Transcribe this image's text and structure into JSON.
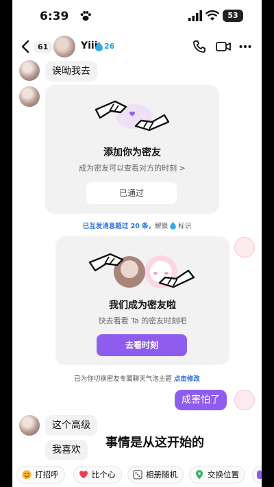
{
  "status_bar": {
    "time": "6:39",
    "battery": "53"
  },
  "header": {
    "unread_count": "61",
    "name": "Yiii",
    "level": "26"
  },
  "messages": {
    "first": "诶呦我去",
    "card1": {
      "title": "添加你为密友",
      "subtitle": "成为密友可以查看对方的时刻 >",
      "button": "已通过"
    },
    "notice1": {
      "prefix": "已互发消息超过 20 条，",
      "action": "解锁",
      "suffix": "标识"
    },
    "card2": {
      "title": "我们成为密友啦",
      "subtitle": "快去看看 Ta 的密友时刻吧",
      "button": "去看时刻"
    },
    "notice2": {
      "text": "已为你切换密友专属聊天气泡主题 ",
      "link": "点击修改"
    },
    "me_text": "成害怕了",
    "reply1": "这个高级",
    "reply2": "我喜欢"
  },
  "caption": "事情是从这开始的",
  "quick_actions": [
    "打招呼",
    "比个心",
    "相册随机",
    "交换位置"
  ],
  "colors": {
    "accent": "#8f5cf0",
    "card_bg": "#f2f2f2",
    "link": "#2b6fd6"
  }
}
